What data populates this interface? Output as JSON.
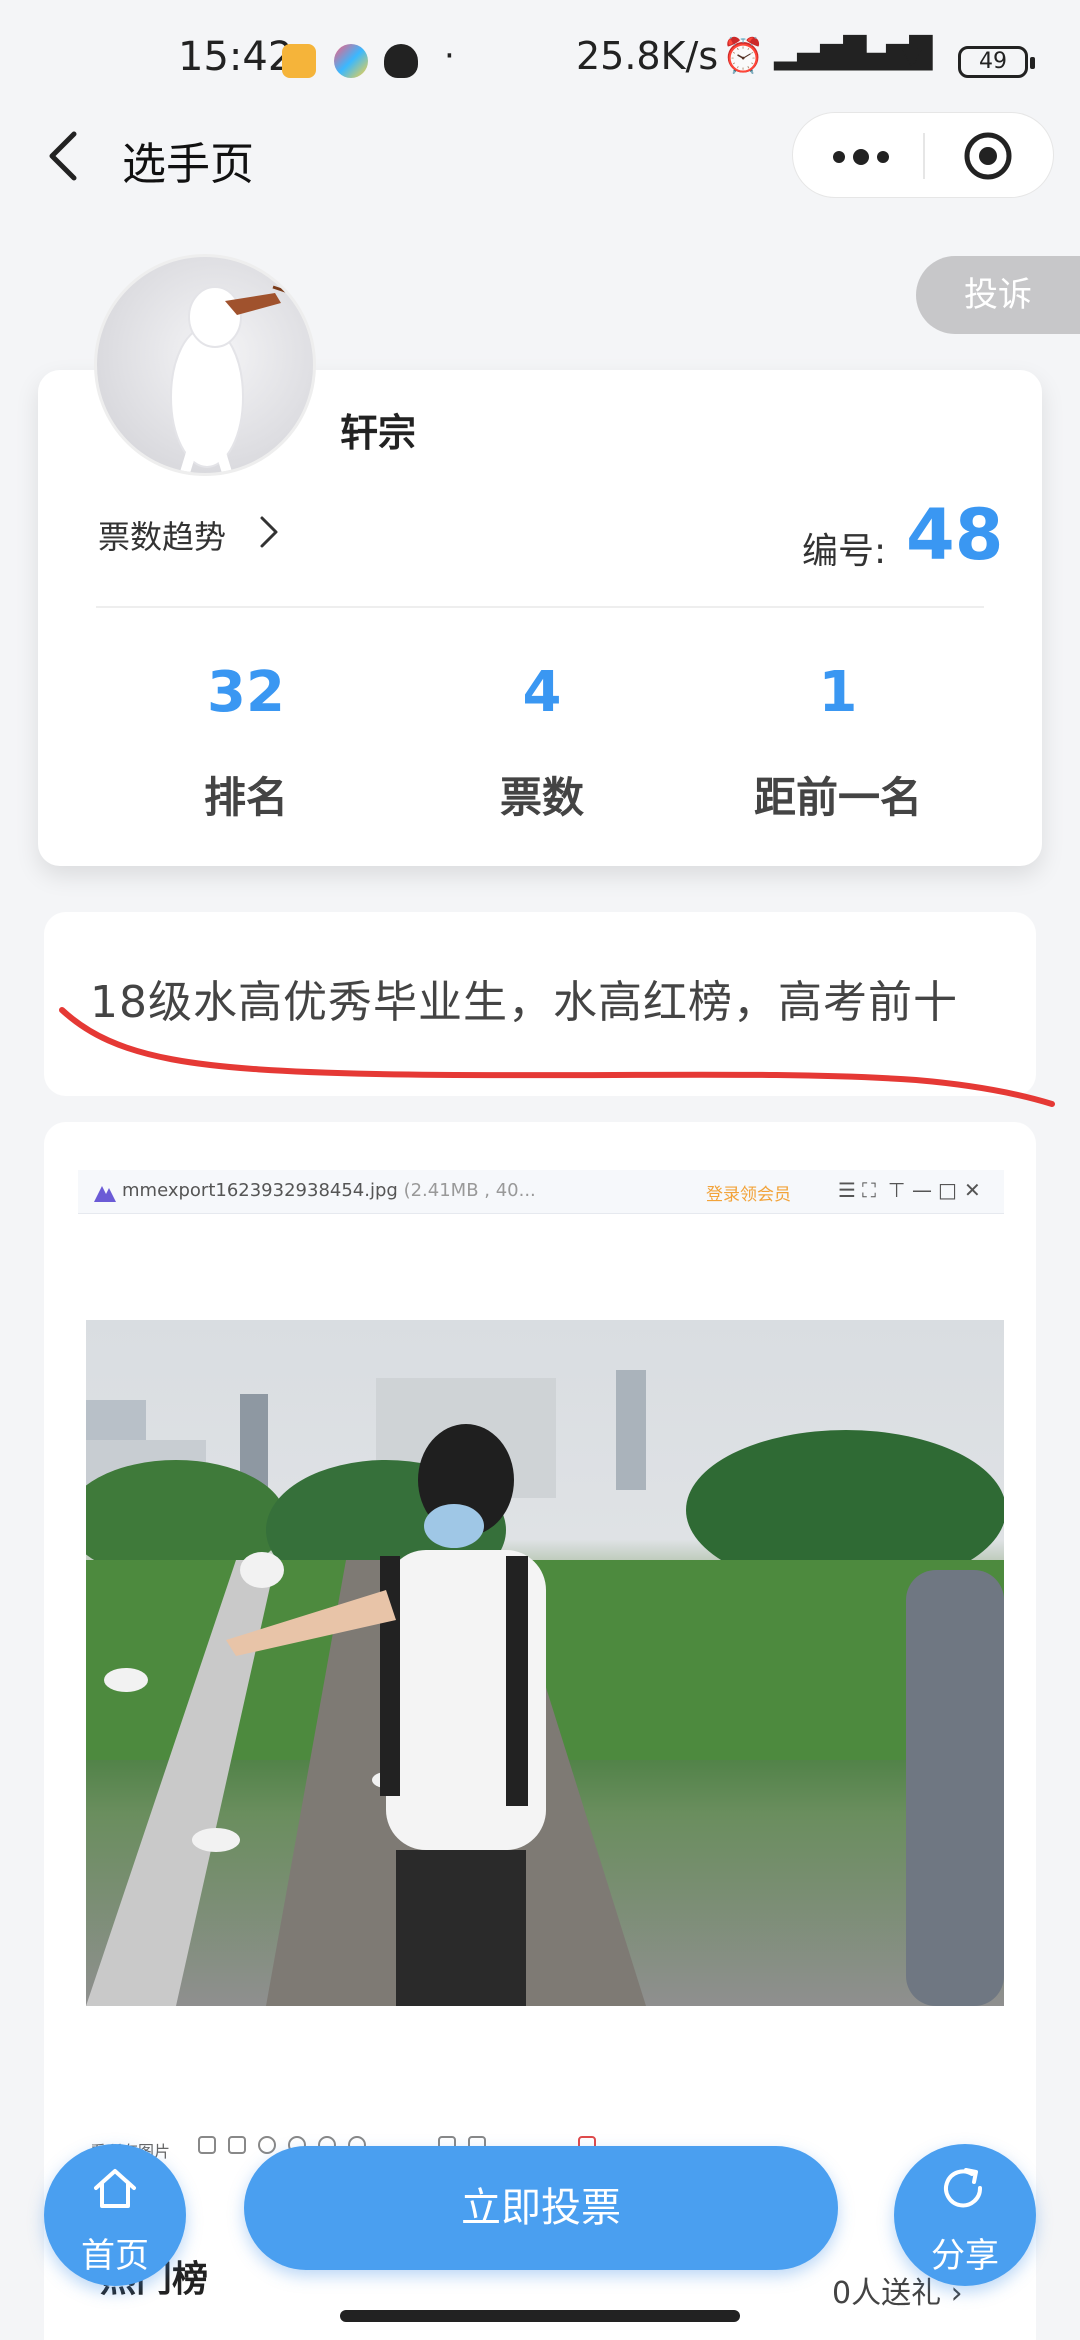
{
  "status_bar": {
    "time": "15:42",
    "network_speed": "25.8K/s",
    "battery": "49",
    "icons": [
      "notes-app-icon",
      "colorful-app-icon",
      "qq-penguin-icon",
      "dot-icon",
      "alarm-icon",
      "hd-signal-icon",
      "hd-signal-icon",
      "wifi-icon",
      "battery-icon"
    ]
  },
  "header": {
    "title": "选手页",
    "back_icon": "chevron-left-icon",
    "more_icon": "more-dots-icon",
    "close_icon": "target-circle-icon"
  },
  "report_button": "投诉",
  "profile": {
    "name": "轩宗",
    "trend_label": "票数趋势",
    "number_label": "编号:",
    "number_value": "48",
    "stats": [
      {
        "value": "32",
        "label": "排名"
      },
      {
        "value": "4",
        "label": "票数"
      },
      {
        "value": "1",
        "label": "距前一名"
      }
    ]
  },
  "bio": {
    "text": "18级水高优秀毕业生，水高红榜，高考前十",
    "mark_color": "#e53935"
  },
  "photo_viewer": {
    "filename": "mmexport1623932938454.jpg",
    "file_meta": "(2.41MB , 40...",
    "vip_text": "登录领会员",
    "controls": [
      "☰",
      "⛶",
      "⊤",
      "—",
      "□",
      "✕"
    ],
    "footer_label": "看所有图片"
  },
  "bottom": {
    "home_label": "首页",
    "vote_label": "立即投票",
    "share_label": "分享",
    "section_title": "热门榜",
    "section_right": "0人送礼 ›"
  },
  "colors": {
    "accent": "#4a9ff0",
    "stat_blue": "#3a97f2",
    "background": "#f4f5f7"
  }
}
